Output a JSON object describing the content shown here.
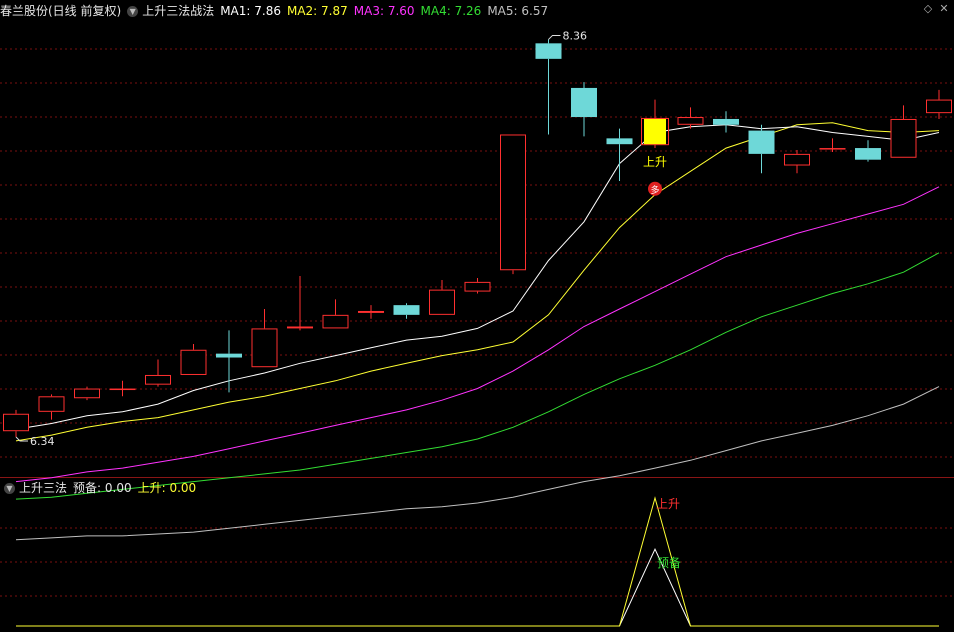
{
  "main_header": {
    "stock": "春兰股份(日线 前复权)",
    "indicator": "上升三法战法",
    "ma1": "MA1: 7.86",
    "ma2": "MA2: 7.87",
    "ma3": "MA3: 7.60",
    "ma4": "MA4: 7.26",
    "ma5": "MA5: 6.57"
  },
  "sub_header": {
    "name": "上升三法",
    "prep": "预备: 0.00",
    "rise": "上升: 0.00"
  },
  "icons": {
    "dropdown": "chevron-down-icon",
    "diamond": "diamond-icon",
    "close": "close-icon"
  },
  "colors": {
    "up": "#ff3030",
    "down": "#6ed8d8",
    "highlight": "#ffff00",
    "ma1": "#ffffff",
    "ma2": "#ffff33",
    "ma3": "#ff33ff",
    "ma4": "#33dd33",
    "ma5": "#c0c0c0",
    "grid": "#7a1010",
    "sub_rise": "#ffff33",
    "sub_prep": "#ffffff",
    "label_rise": "#ff3030",
    "label_prep": "#33dd33"
  },
  "chart_data": {
    "type": "candlestick",
    "price_range": [
      6.14,
      8.45
    ],
    "candles": [
      {
        "o": 6.34,
        "h": 6.45,
        "l": 6.31,
        "c": 6.43
      },
      {
        "o": 6.44,
        "h": 6.53,
        "l": 6.4,
        "c": 6.52
      },
      {
        "o": 6.51,
        "h": 6.57,
        "l": 6.5,
        "c": 6.56
      },
      {
        "o": 6.56,
        "h": 6.6,
        "l": 6.52,
        "c": 6.56
      },
      {
        "o": 6.58,
        "h": 6.71,
        "l": 6.57,
        "c": 6.63
      },
      {
        "o": 6.63,
        "h": 6.79,
        "l": 6.63,
        "c": 6.76
      },
      {
        "o": 6.74,
        "h": 6.86,
        "l": 6.54,
        "c": 6.72
      },
      {
        "o": 6.67,
        "h": 6.97,
        "l": 6.67,
        "c": 6.87
      },
      {
        "o": 6.87,
        "h": 7.14,
        "l": 6.86,
        "c": 6.88
      },
      {
        "o": 6.87,
        "h": 7.02,
        "l": 6.87,
        "c": 6.94
      },
      {
        "o": 6.95,
        "h": 6.99,
        "l": 6.92,
        "c": 6.96
      },
      {
        "o": 6.99,
        "h": 7.0,
        "l": 6.92,
        "c": 6.94
      },
      {
        "o": 6.94,
        "h": 7.12,
        "l": 6.94,
        "c": 7.07
      },
      {
        "o": 7.06,
        "h": 7.13,
        "l": 7.05,
        "c": 7.11
      },
      {
        "o": 7.17,
        "h": 7.87,
        "l": 7.15,
        "c": 7.87
      },
      {
        "o": 8.34,
        "h": 8.36,
        "l": 7.87,
        "c": 8.26
      },
      {
        "o": 8.11,
        "h": 8.14,
        "l": 7.86,
        "c": 7.96
      },
      {
        "o": 7.85,
        "h": 7.9,
        "l": 7.63,
        "c": 7.82
      },
      {
        "o": 7.82,
        "h": 8.05,
        "l": 7.8,
        "c": 7.95
      },
      {
        "o": 7.92,
        "h": 8.01,
        "l": 7.9,
        "c": 7.96
      },
      {
        "o": 7.95,
        "h": 7.99,
        "l": 7.88,
        "c": 7.92
      },
      {
        "o": 7.89,
        "h": 7.92,
        "l": 7.67,
        "c": 7.77
      },
      {
        "o": 7.71,
        "h": 7.79,
        "l": 7.67,
        "c": 7.77
      },
      {
        "o": 7.8,
        "h": 7.85,
        "l": 7.78,
        "c": 7.8
      },
      {
        "o": 7.8,
        "h": 7.84,
        "l": 7.73,
        "c": 7.74
      },
      {
        "o": 7.75,
        "h": 8.02,
        "l": 7.75,
        "c": 7.95
      },
      {
        "o": 7.98,
        "h": 8.1,
        "l": 7.95,
        "c": 8.05
      }
    ],
    "highlight_index": 18,
    "high_label": {
      "index": 15,
      "text": "8.36"
    },
    "low_label": {
      "index": 0,
      "text": "6.34"
    },
    "rise_label": {
      "index": 18,
      "text": "上升"
    },
    "duo_marker": {
      "index": 18,
      "text": "多",
      "price": 7.59
    },
    "series": [
      {
        "name": "MA1",
        "values": [
          6.35,
          6.38,
          6.42,
          6.44,
          6.48,
          6.55,
          6.6,
          6.64,
          6.69,
          6.73,
          6.77,
          6.81,
          6.83,
          6.87,
          6.96,
          7.22,
          7.42,
          7.72,
          7.88,
          7.91,
          7.92,
          7.9,
          7.91,
          7.88,
          7.86,
          7.84,
          7.88
        ]
      },
      {
        "name": "MA2",
        "values": [
          6.29,
          6.32,
          6.36,
          6.39,
          6.41,
          6.45,
          6.49,
          6.52,
          6.56,
          6.6,
          6.65,
          6.69,
          6.73,
          6.76,
          6.8,
          6.94,
          7.17,
          7.39,
          7.56,
          7.68,
          7.8,
          7.86,
          7.92,
          7.93,
          7.89,
          7.88,
          7.89
        ]
      },
      {
        "name": "MA3",
        "values": [
          6.08,
          6.1,
          6.13,
          6.15,
          6.18,
          6.21,
          6.25,
          6.29,
          6.33,
          6.37,
          6.41,
          6.45,
          6.5,
          6.56,
          6.65,
          6.76,
          6.88,
          6.97,
          7.06,
          7.15,
          7.24,
          7.3,
          7.36,
          7.41,
          7.46,
          7.51,
          7.6
        ]
      },
      {
        "name": "MA4",
        "values": [
          5.99,
          6.0,
          6.02,
          6.04,
          6.06,
          6.08,
          6.1,
          6.12,
          6.14,
          6.17,
          6.2,
          6.23,
          6.26,
          6.3,
          6.36,
          6.44,
          6.53,
          6.61,
          6.68,
          6.76,
          6.85,
          6.93,
          6.99,
          7.05,
          7.1,
          7.16,
          7.26
        ]
      },
      {
        "name": "MA5",
        "values": [
          5.78,
          5.79,
          5.8,
          5.8,
          5.81,
          5.82,
          5.84,
          5.86,
          5.88,
          5.9,
          5.92,
          5.94,
          5.95,
          5.97,
          6.0,
          6.04,
          6.08,
          6.11,
          6.15,
          6.19,
          6.24,
          6.29,
          6.33,
          6.37,
          6.42,
          6.48,
          6.57
        ]
      }
    ],
    "sub_chart": {
      "range": [
        0,
        1
      ],
      "rise": [
        0,
        0,
        0,
        0,
        0,
        0,
        0,
        0,
        0,
        0,
        0,
        0,
        0,
        0,
        0,
        0,
        0,
        0,
        1,
        0,
        0,
        0,
        0,
        0,
        0,
        0,
        0
      ],
      "prep": [
        0,
        0,
        0,
        0,
        0,
        0,
        0,
        0,
        0,
        0,
        0,
        0,
        0,
        0,
        0,
        0,
        0,
        0,
        0.6,
        0,
        0,
        0,
        0,
        0,
        0,
        0,
        0
      ],
      "rise_label": "上升",
      "prep_label": "预备",
      "label_index": 18
    }
  }
}
